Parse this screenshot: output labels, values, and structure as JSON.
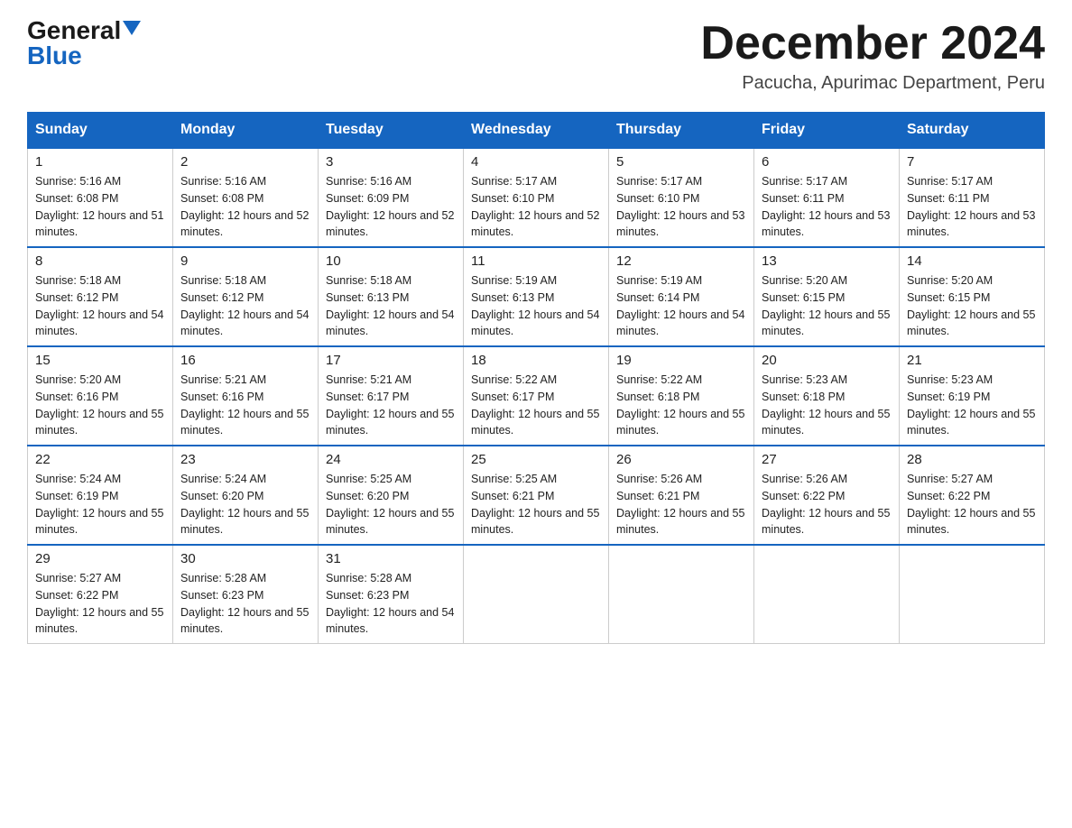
{
  "header": {
    "logo_general": "General",
    "logo_blue": "Blue",
    "month_title": "December 2024",
    "location": "Pacucha, Apurimac Department, Peru"
  },
  "days_of_week": [
    "Sunday",
    "Monday",
    "Tuesday",
    "Wednesday",
    "Thursday",
    "Friday",
    "Saturday"
  ],
  "weeks": [
    [
      {
        "day": "1",
        "sunrise": "5:16 AM",
        "sunset": "6:08 PM",
        "daylight": "12 hours and 51 minutes."
      },
      {
        "day": "2",
        "sunrise": "5:16 AM",
        "sunset": "6:08 PM",
        "daylight": "12 hours and 52 minutes."
      },
      {
        "day": "3",
        "sunrise": "5:16 AM",
        "sunset": "6:09 PM",
        "daylight": "12 hours and 52 minutes."
      },
      {
        "day": "4",
        "sunrise": "5:17 AM",
        "sunset": "6:10 PM",
        "daylight": "12 hours and 52 minutes."
      },
      {
        "day": "5",
        "sunrise": "5:17 AM",
        "sunset": "6:10 PM",
        "daylight": "12 hours and 53 minutes."
      },
      {
        "day": "6",
        "sunrise": "5:17 AM",
        "sunset": "6:11 PM",
        "daylight": "12 hours and 53 minutes."
      },
      {
        "day": "7",
        "sunrise": "5:17 AM",
        "sunset": "6:11 PM",
        "daylight": "12 hours and 53 minutes."
      }
    ],
    [
      {
        "day": "8",
        "sunrise": "5:18 AM",
        "sunset": "6:12 PM",
        "daylight": "12 hours and 54 minutes."
      },
      {
        "day": "9",
        "sunrise": "5:18 AM",
        "sunset": "6:12 PM",
        "daylight": "12 hours and 54 minutes."
      },
      {
        "day": "10",
        "sunrise": "5:18 AM",
        "sunset": "6:13 PM",
        "daylight": "12 hours and 54 minutes."
      },
      {
        "day": "11",
        "sunrise": "5:19 AM",
        "sunset": "6:13 PM",
        "daylight": "12 hours and 54 minutes."
      },
      {
        "day": "12",
        "sunrise": "5:19 AM",
        "sunset": "6:14 PM",
        "daylight": "12 hours and 54 minutes."
      },
      {
        "day": "13",
        "sunrise": "5:20 AM",
        "sunset": "6:15 PM",
        "daylight": "12 hours and 55 minutes."
      },
      {
        "day": "14",
        "sunrise": "5:20 AM",
        "sunset": "6:15 PM",
        "daylight": "12 hours and 55 minutes."
      }
    ],
    [
      {
        "day": "15",
        "sunrise": "5:20 AM",
        "sunset": "6:16 PM",
        "daylight": "12 hours and 55 minutes."
      },
      {
        "day": "16",
        "sunrise": "5:21 AM",
        "sunset": "6:16 PM",
        "daylight": "12 hours and 55 minutes."
      },
      {
        "day": "17",
        "sunrise": "5:21 AM",
        "sunset": "6:17 PM",
        "daylight": "12 hours and 55 minutes."
      },
      {
        "day": "18",
        "sunrise": "5:22 AM",
        "sunset": "6:17 PM",
        "daylight": "12 hours and 55 minutes."
      },
      {
        "day": "19",
        "sunrise": "5:22 AM",
        "sunset": "6:18 PM",
        "daylight": "12 hours and 55 minutes."
      },
      {
        "day": "20",
        "sunrise": "5:23 AM",
        "sunset": "6:18 PM",
        "daylight": "12 hours and 55 minutes."
      },
      {
        "day": "21",
        "sunrise": "5:23 AM",
        "sunset": "6:19 PM",
        "daylight": "12 hours and 55 minutes."
      }
    ],
    [
      {
        "day": "22",
        "sunrise": "5:24 AM",
        "sunset": "6:19 PM",
        "daylight": "12 hours and 55 minutes."
      },
      {
        "day": "23",
        "sunrise": "5:24 AM",
        "sunset": "6:20 PM",
        "daylight": "12 hours and 55 minutes."
      },
      {
        "day": "24",
        "sunrise": "5:25 AM",
        "sunset": "6:20 PM",
        "daylight": "12 hours and 55 minutes."
      },
      {
        "day": "25",
        "sunrise": "5:25 AM",
        "sunset": "6:21 PM",
        "daylight": "12 hours and 55 minutes."
      },
      {
        "day": "26",
        "sunrise": "5:26 AM",
        "sunset": "6:21 PM",
        "daylight": "12 hours and 55 minutes."
      },
      {
        "day": "27",
        "sunrise": "5:26 AM",
        "sunset": "6:22 PM",
        "daylight": "12 hours and 55 minutes."
      },
      {
        "day": "28",
        "sunrise": "5:27 AM",
        "sunset": "6:22 PM",
        "daylight": "12 hours and 55 minutes."
      }
    ],
    [
      {
        "day": "29",
        "sunrise": "5:27 AM",
        "sunset": "6:22 PM",
        "daylight": "12 hours and 55 minutes."
      },
      {
        "day": "30",
        "sunrise": "5:28 AM",
        "sunset": "6:23 PM",
        "daylight": "12 hours and 55 minutes."
      },
      {
        "day": "31",
        "sunrise": "5:28 AM",
        "sunset": "6:23 PM",
        "daylight": "12 hours and 54 minutes."
      },
      null,
      null,
      null,
      null
    ]
  ],
  "labels": {
    "sunrise_prefix": "Sunrise: ",
    "sunset_prefix": "Sunset: ",
    "daylight_prefix": "Daylight: "
  }
}
